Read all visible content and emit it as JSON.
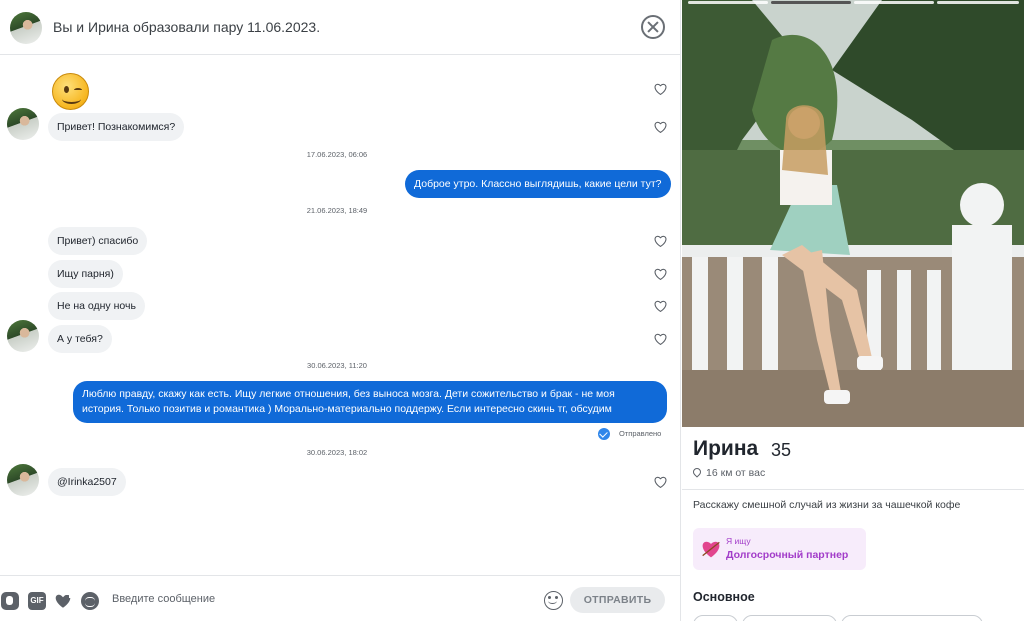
{
  "chat": {
    "header_title": "Вы и Ирина образовали пару 11.06.2023.",
    "messages": {
      "first_incoming": "Привет! Познакомимся?",
      "stamp_1": "17.06.2023, 06:06",
      "outgoing_1": "Доброе утро. Классно выглядишь, какие цели тут?",
      "stamp_2": "21.06.2023, 18:49",
      "incoming_2": "Привет) спасибо",
      "incoming_3": "Ищу парня)",
      "incoming_4": "Не на одну ночь",
      "incoming_5": "А у тебя?",
      "stamp_3": "30.06.2023, 11:20",
      "outgoing_2": "Люблю правду, скажу как есть. Ищу легкие отношения, без выноса мозга. Дети сожительство и брак - не моя история. Только позитив и романтика ) Морально-материально поддержу. Если интересно скинь тг, обсудим",
      "sent_status": "Отправлено",
      "stamp_4": "30.06.2023, 18:02",
      "incoming_6": "@Irinka2507"
    },
    "composer": {
      "gif_label": "GIF",
      "placeholder": "Введите сообщение",
      "send_label": "ОТПРАВИТЬ"
    },
    "colors": {
      "outgoing_bubble": "#106ad8",
      "incoming_bubble": "#f0f2f4"
    }
  },
  "profile": {
    "name": "Ирина",
    "age": "35",
    "distance": "16 км от вас",
    "bio": "Расскажу смешной случай из жизни за чашечкой кофе",
    "looking_for_label": "Я ищу",
    "looking_for_value": "Долгосрочный партнер",
    "basics_title": "Основное",
    "accent_color": "#a23cc9"
  }
}
